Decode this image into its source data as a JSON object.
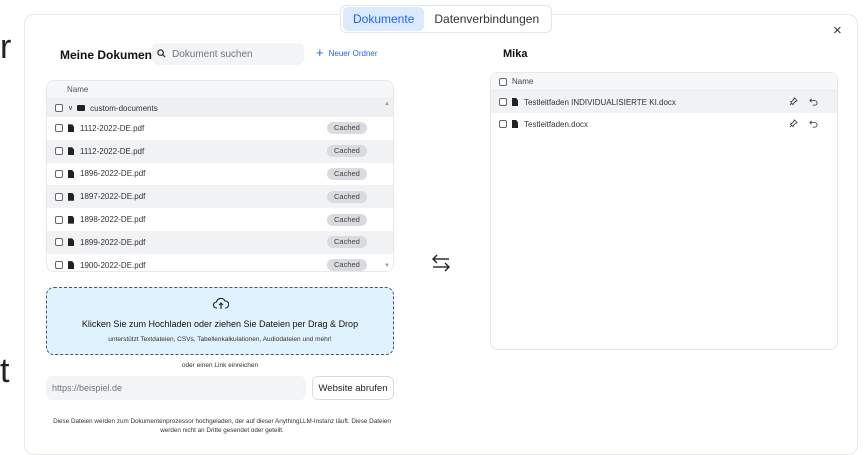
{
  "background_letters": {
    "top": "r",
    "bottom": "t"
  },
  "tabs": [
    {
      "label": "Dokumente",
      "active": true
    },
    {
      "label": "Datenverbindungen",
      "active": false
    }
  ],
  "close_glyph": "×",
  "left": {
    "title": "Meine Dokumente",
    "search_placeholder": "Dokument suchen",
    "new_folder_label": "Neuer Ordner",
    "table_header": "Name",
    "folder": {
      "name": "custom-documents"
    },
    "files": [
      {
        "name": "1112-2022-DE.pdf",
        "status": "Cached"
      },
      {
        "name": "1112-2022-DE.pdf",
        "status": "Cached"
      },
      {
        "name": "1896-2022-DE.pdf",
        "status": "Cached"
      },
      {
        "name": "1897-2022-DE.pdf",
        "status": "Cached"
      },
      {
        "name": "1898-2022-DE.pdf",
        "status": "Cached"
      },
      {
        "name": "1899-2022-DE.pdf",
        "status": "Cached"
      },
      {
        "name": "1900-2022-DE.pdf",
        "status": "Cached"
      }
    ]
  },
  "upload": {
    "title": "Klicken Sie zum Hochladen oder ziehen Sie Dateien per Drag & Drop",
    "subtitle": "unterstützt Textdateien, CSVs, Tabellenkalkulationen, Audiodateien und mehr!",
    "or_link": "oder einen Link einreichen",
    "url_placeholder": "https://beispiel.de",
    "fetch_button": "Website abrufen",
    "disclaimer": "Diese Dateien werden zum Dokumentenprozessor hochgeladen, der auf dieser AnythingLLM-Instanz läuft. Diese Dateien werden nicht an Dritte gesendet oder geteilt."
  },
  "right": {
    "title": "Mika",
    "table_header": "Name",
    "files": [
      {
        "name": "Testleitfaden INDIVIDUALISIERTE KI.docx"
      },
      {
        "name": "Testleitfaden.docx"
      }
    ]
  },
  "icons": {
    "search": "search-icon",
    "plus": "plus-icon",
    "folder": "folder-icon",
    "file": "file-icon",
    "upload": "cloud-upload-icon",
    "swap": "swap-arrows-icon",
    "pin": "pin-icon",
    "undo": "undo-icon"
  },
  "colors": {
    "accent": "#2563eb",
    "tab_active_bg": "#dbeafe",
    "dropzone_bg": "#e0f2fe",
    "badge_bg": "#d9dbde"
  }
}
